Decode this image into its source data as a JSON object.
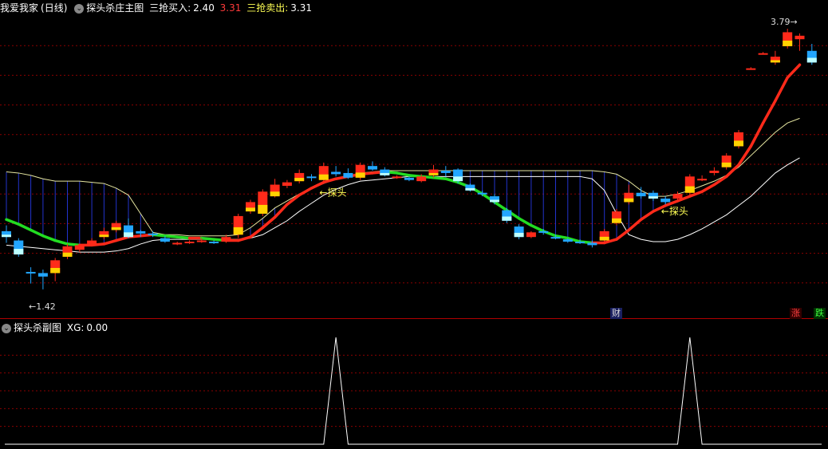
{
  "main_header": {
    "stock_name": "我爱我家",
    "period": "(日线)",
    "indicator_name": "探头杀庄主图",
    "buy_label": "三抢买入:",
    "buy_value": "2.40",
    "mid_value": "3.31",
    "sell_label": "三抢卖出:",
    "sell_value": "3.31"
  },
  "sub_header": {
    "indicator_name": "探头杀副图",
    "xg_label": "XG:",
    "xg_value": "0.00"
  },
  "annotations": {
    "high_price": "3.79",
    "low_price": "1.42",
    "signal_text": "探头",
    "cai_tag": "财",
    "zhang_tag": "涨",
    "die_tag": "跌"
  },
  "colors": {
    "up_red": "#ff2a1a",
    "down_cyan": "#22a6ff",
    "support_green": "#22dd22",
    "yellow": "#ffff55",
    "grid_red": "#8a0000"
  },
  "chart_data": {
    "type": "candlestick",
    "price_range": [
      1.35,
      3.9
    ],
    "candles": [
      {
        "o": 2.05,
        "c": 2.0,
        "h": 2.1,
        "l": 1.95
      },
      {
        "o": 1.97,
        "c": 1.85,
        "h": 1.99,
        "l": 1.83
      },
      {
        "o": 1.7,
        "c": 1.69,
        "h": 1.74,
        "l": 1.6
      },
      {
        "o": 1.69,
        "c": 1.66,
        "h": 1.72,
        "l": 1.55
      },
      {
        "o": 1.69,
        "c": 1.8,
        "h": 1.82,
        "l": 1.62
      },
      {
        "o": 1.83,
        "c": 1.92,
        "h": 1.94,
        "l": 1.81
      },
      {
        "o": 1.89,
        "c": 1.93,
        "h": 1.94,
        "l": 1.87
      },
      {
        "o": 1.94,
        "c": 1.97,
        "h": 1.99,
        "l": 1.93
      },
      {
        "o": 2.0,
        "c": 2.05,
        "h": 2.08,
        "l": 1.98
      },
      {
        "o": 2.06,
        "c": 2.12,
        "h": 2.14,
        "l": 2.04
      },
      {
        "o": 2.1,
        "c": 2.0,
        "h": 2.16,
        "l": 1.99
      },
      {
        "o": 2.05,
        "c": 2.03,
        "h": 2.06,
        "l": 2.0
      },
      {
        "o": 2.03,
        "c": 2.02,
        "h": 2.05,
        "l": 2.0
      },
      {
        "o": 1.99,
        "c": 1.96,
        "h": 2.01,
        "l": 1.95
      },
      {
        "o": 1.94,
        "c": 1.95,
        "h": 1.96,
        "l": 1.93
      },
      {
        "o": 1.95,
        "c": 1.96,
        "h": 1.97,
        "l": 1.94
      },
      {
        "o": 1.96,
        "c": 1.97,
        "h": 1.99,
        "l": 1.95
      },
      {
        "o": 1.96,
        "c": 1.95,
        "h": 1.97,
        "l": 1.94
      },
      {
        "o": 1.96,
        "c": 2.0,
        "h": 2.02,
        "l": 1.95
      },
      {
        "o": 2.02,
        "c": 2.18,
        "h": 2.2,
        "l": 1.99
      },
      {
        "o": 2.22,
        "c": 2.3,
        "h": 2.32,
        "l": 2.2
      },
      {
        "o": 2.2,
        "c": 2.39,
        "h": 2.41,
        "l": 2.18
      },
      {
        "o": 2.35,
        "c": 2.45,
        "h": 2.5,
        "l": 2.34
      },
      {
        "o": 2.44,
        "c": 2.47,
        "h": 2.49,
        "l": 2.42
      },
      {
        "o": 2.48,
        "c": 2.55,
        "h": 2.58,
        "l": 2.46
      },
      {
        "o": 2.52,
        "c": 2.51,
        "h": 2.54,
        "l": 2.48
      },
      {
        "o": 2.49,
        "c": 2.61,
        "h": 2.64,
        "l": 2.47
      },
      {
        "o": 2.56,
        "c": 2.54,
        "h": 2.61,
        "l": 2.52
      },
      {
        "o": 2.55,
        "c": 2.51,
        "h": 2.59,
        "l": 2.5
      },
      {
        "o": 2.51,
        "c": 2.62,
        "h": 2.64,
        "l": 2.49
      },
      {
        "o": 2.61,
        "c": 2.58,
        "h": 2.65,
        "l": 2.57
      },
      {
        "o": 2.58,
        "c": 2.53,
        "h": 2.6,
        "l": 2.52
      },
      {
        "o": 2.51,
        "c": 2.52,
        "h": 2.53,
        "l": 2.5
      },
      {
        "o": 2.51,
        "c": 2.49,
        "h": 2.52,
        "l": 2.48
      },
      {
        "o": 2.48,
        "c": 2.52,
        "h": 2.54,
        "l": 2.47
      },
      {
        "o": 2.53,
        "c": 2.58,
        "h": 2.62,
        "l": 2.51
      },
      {
        "o": 2.57,
        "c": 2.55,
        "h": 2.61,
        "l": 2.52
      },
      {
        "o": 2.58,
        "c": 2.48,
        "h": 2.59,
        "l": 2.46
      },
      {
        "o": 2.45,
        "c": 2.4,
        "h": 2.46,
        "l": 2.39
      },
      {
        "o": 2.38,
        "c": 2.37,
        "h": 2.4,
        "l": 2.35
      },
      {
        "o": 2.35,
        "c": 2.3,
        "h": 2.37,
        "l": 2.28
      },
      {
        "o": 2.23,
        "c": 2.14,
        "h": 2.25,
        "l": 2.12
      },
      {
        "o": 2.09,
        "c": 2.0,
        "h": 2.11,
        "l": 1.98
      },
      {
        "o": 2.0,
        "c": 2.04,
        "h": 2.05,
        "l": 1.99
      },
      {
        "o": 2.05,
        "c": 2.04,
        "h": 2.07,
        "l": 2.02
      },
      {
        "o": 2.0,
        "c": 1.99,
        "h": 2.02,
        "l": 1.98
      },
      {
        "o": 1.98,
        "c": 1.96,
        "h": 1.99,
        "l": 1.95
      },
      {
        "o": 1.96,
        "c": 1.95,
        "h": 1.98,
        "l": 1.94
      },
      {
        "o": 1.95,
        "c": 1.93,
        "h": 1.97,
        "l": 1.91
      },
      {
        "o": 1.97,
        "c": 2.05,
        "h": 2.07,
        "l": 1.96
      },
      {
        "o": 2.12,
        "c": 2.22,
        "h": 2.24,
        "l": 2.1
      },
      {
        "o": 2.3,
        "c": 2.38,
        "h": 2.45,
        "l": 2.28
      },
      {
        "o": 2.38,
        "c": 2.35,
        "h": 2.43,
        "l": 2.33
      },
      {
        "o": 2.38,
        "c": 2.33,
        "h": 2.4,
        "l": 2.31
      },
      {
        "o": 2.33,
        "c": 2.3,
        "h": 2.35,
        "l": 2.28
      },
      {
        "o": 2.33,
        "c": 2.37,
        "h": 2.39,
        "l": 2.31
      },
      {
        "o": 2.38,
        "c": 2.52,
        "h": 2.54,
        "l": 2.36
      },
      {
        "o": 2.49,
        "c": 2.5,
        "h": 2.53,
        "l": 2.48
      },
      {
        "o": 2.55,
        "c": 2.57,
        "h": 2.6,
        "l": 2.53
      },
      {
        "o": 2.6,
        "c": 2.7,
        "h": 2.72,
        "l": 2.58
      },
      {
        "o": 2.78,
        "c": 2.9,
        "h": 2.92,
        "l": 2.76
      },
      {
        "o": 3.45,
        "c": 3.45,
        "h": 3.46,
        "l": 3.44
      },
      {
        "o": 3.58,
        "c": 3.58,
        "h": 3.59,
        "l": 3.57
      },
      {
        "o": 3.5,
        "c": 3.55,
        "h": 3.6,
        "l": 3.48
      },
      {
        "o": 3.64,
        "c": 3.76,
        "h": 3.79,
        "l": 3.62
      },
      {
        "o": 3.7,
        "c": 3.73,
        "h": 3.75,
        "l": 3.6
      },
      {
        "o": 3.6,
        "c": 3.5,
        "h": 3.66,
        "l": 3.48
      }
    ],
    "support_line": [
      2.15,
      2.11,
      2.06,
      2.01,
      1.97,
      1.94,
      1.93,
      1.93,
      1.94,
      1.97,
      2.0,
      2.01,
      2.02,
      2.01,
      2.0,
      1.99,
      1.99,
      1.98,
      1.97,
      1.97,
      2.0,
      2.08,
      2.17,
      2.28,
      2.36,
      2.42,
      2.47,
      2.5,
      2.52,
      2.54,
      2.55,
      2.56,
      2.55,
      2.53,
      2.52,
      2.51,
      2.5,
      2.47,
      2.43,
      2.37,
      2.3,
      2.23,
      2.16,
      2.1,
      2.05,
      2.01,
      1.99,
      1.96,
      1.95,
      1.95,
      1.98,
      2.06,
      2.15,
      2.22,
      2.27,
      2.31,
      2.35,
      2.39,
      2.45,
      2.52,
      2.62,
      2.78,
      2.98,
      3.17,
      3.37,
      3.48
    ],
    "upper_band": [
      2.56,
      2.55,
      2.53,
      2.5,
      2.48,
      2.48,
      2.48,
      2.47,
      2.46,
      2.42,
      2.36,
      2.2,
      2.04,
      2.02,
      2.02,
      2.01,
      2.01,
      2.01,
      2.01,
      2.02,
      2.08,
      2.16,
      2.25,
      2.31,
      2.37,
      2.42,
      2.46,
      2.5,
      2.52,
      2.55,
      2.56,
      2.57,
      2.57,
      2.57,
      2.57,
      2.57,
      2.57,
      2.57,
      2.57,
      2.57,
      2.57,
      2.57,
      2.57,
      2.57,
      2.57,
      2.57,
      2.57,
      2.57,
      2.57,
      2.56,
      2.54,
      2.48,
      2.4,
      2.35,
      2.35,
      2.37,
      2.4,
      2.44,
      2.48,
      2.53,
      2.6,
      2.7,
      2.8,
      2.9,
      2.98,
      3.02
    ],
    "lower_line": [
      1.93,
      1.92,
      1.91,
      1.9,
      1.89,
      1.88,
      1.87,
      1.87,
      1.87,
      1.88,
      1.9,
      1.94,
      1.97,
      1.98,
      1.98,
      1.98,
      1.98,
      1.98,
      1.98,
      1.98,
      1.99,
      2.02,
      2.08,
      2.14,
      2.22,
      2.29,
      2.36,
      2.41,
      2.45,
      2.48,
      2.49,
      2.5,
      2.51,
      2.52,
      2.52,
      2.52,
      2.52,
      2.52,
      2.52,
      2.52,
      2.52,
      2.52,
      2.52,
      2.52,
      2.52,
      2.52,
      2.52,
      2.52,
      2.5,
      2.4,
      2.2,
      2.02,
      1.98,
      1.96,
      1.96,
      1.98,
      2.02,
      2.07,
      2.13,
      2.19,
      2.27,
      2.35,
      2.45,
      2.55,
      2.62,
      2.68
    ],
    "signals": [
      {
        "index": 28,
        "price": 2.38,
        "label": "探头"
      },
      {
        "index": 56,
        "price": 2.22,
        "label": "探头"
      }
    ],
    "xg": [
      0,
      0,
      0,
      0,
      0,
      0,
      0,
      0,
      0,
      0,
      0,
      0,
      0,
      0,
      0,
      0,
      0,
      0,
      0,
      0,
      0,
      0,
      0,
      0,
      0,
      0,
      0,
      1,
      0,
      0,
      0,
      0,
      0,
      0,
      0,
      0,
      0,
      0,
      0,
      0,
      0,
      0,
      0,
      0,
      0,
      0,
      0,
      0,
      0,
      0,
      0,
      0,
      0,
      0,
      0,
      0,
      1,
      0,
      0,
      0,
      0,
      0,
      0,
      0,
      0,
      0
    ],
    "xg_range": [
      0,
      1
    ]
  }
}
